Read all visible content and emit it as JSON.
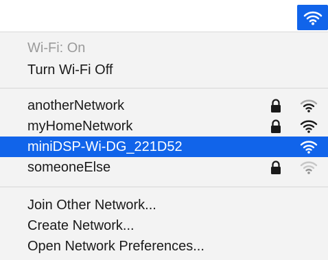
{
  "colors": {
    "accent": "#1164ea",
    "menu_bg": "#f3f3f3",
    "text": "#1a1a1a",
    "disabled_text": "#9a9a9a"
  },
  "menubar": {
    "wifi_icon": "wifi-icon"
  },
  "status": {
    "label": "Wi-Fi: On",
    "toggle_label": "Turn Wi-Fi Off"
  },
  "networks": [
    {
      "name": "anotherNetwork",
      "locked": true,
      "signal": "full",
      "selected": false
    },
    {
      "name": "myHomeNetwork",
      "locked": true,
      "signal": "full",
      "selected": false
    },
    {
      "name": "miniDSP-Wi-DG_221D52",
      "locked": false,
      "signal": "full",
      "selected": true
    },
    {
      "name": "someoneElse",
      "locked": true,
      "signal": "weak",
      "selected": false
    }
  ],
  "actions": {
    "join_other": "Join Other Network...",
    "create": "Create Network...",
    "preferences": "Open Network Preferences..."
  }
}
